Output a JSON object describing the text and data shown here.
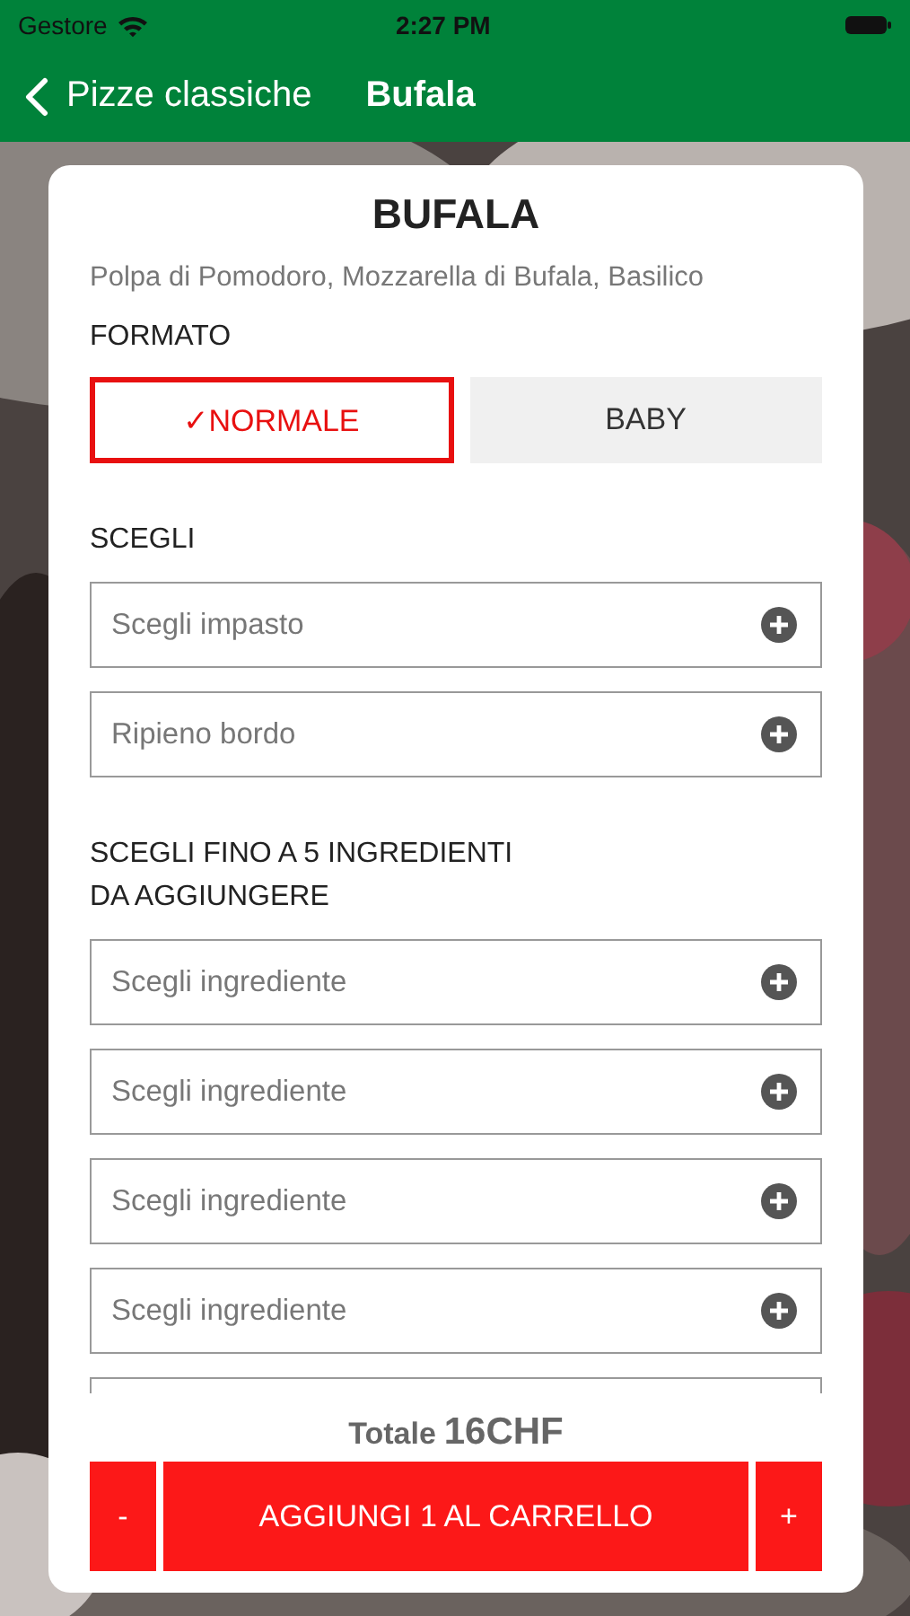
{
  "status_bar": {
    "carrier": "Gestore",
    "time": "2:27 PM"
  },
  "nav": {
    "back_label": "Pizze classiche",
    "title": "Bufala"
  },
  "product": {
    "name": "BUFALA",
    "description": "Polpa di Pomodoro, Mozzarella di Bufala, Basilico"
  },
  "format": {
    "label": "FORMATO",
    "options": [
      {
        "label": "NORMALE",
        "selected": true,
        "check_mark": "✓"
      },
      {
        "label": "BABY",
        "selected": false
      }
    ]
  },
  "choose": {
    "label": "SCEGLI",
    "fields": [
      {
        "kind": "field",
        "placeholder": "Scegli impasto"
      },
      {
        "kind": "field",
        "placeholder": "Ripieno bordo"
      }
    ]
  },
  "extras": {
    "label": "SCEGLI FINO A 5 INGREDIENTI\nDA AGGIUNGERE",
    "fields": [
      {
        "kind": "field",
        "placeholder": "Scegli ingrediente"
      },
      {
        "kind": "field",
        "placeholder": "Scegli ingrediente"
      },
      {
        "kind": "field",
        "placeholder": "Scegli ingrediente"
      },
      {
        "kind": "field",
        "placeholder": "Scegli ingrediente"
      },
      {
        "kind": "cut"
      }
    ]
  },
  "total": {
    "label": "Totale",
    "amount": "16CHF"
  },
  "cart": {
    "minus": "-",
    "add_label": "AGGIUNGI 1 AL CARRELLO",
    "plus": "+"
  }
}
